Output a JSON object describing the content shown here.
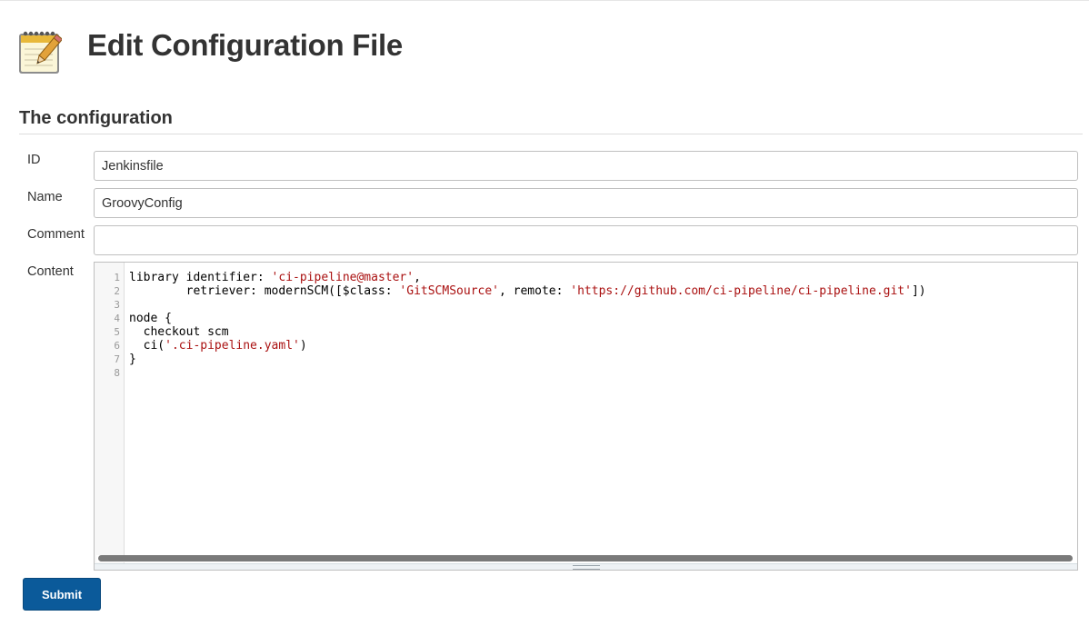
{
  "header": {
    "icon": "notepad-pencil-icon",
    "title": "Edit Configuration File"
  },
  "section": {
    "title": "The configuration"
  },
  "fields": {
    "id": {
      "label": "ID",
      "value": "Jenkinsfile"
    },
    "name": {
      "label": "Name",
      "value": "GroovyConfig"
    },
    "comment": {
      "label": "Comment",
      "value": ""
    },
    "content": {
      "label": "Content"
    }
  },
  "editor": {
    "line_numbers": [
      "1",
      "2",
      "3",
      "4",
      "5",
      "6",
      "7",
      "8"
    ],
    "lines": [
      {
        "plain1": "library identifier: ",
        "str1": "'ci-pipeline@master'",
        "plain2": ",",
        "str2": "",
        "plain3": "",
        "str3": "",
        "plain4": ""
      },
      {
        "plain1": "        retriever: modernSCM([$class: ",
        "str1": "'GitSCMSource'",
        "plain2": ", remote: ",
        "str2": "'https://github.com/ci-pipeline/ci-pipeline.git'",
        "plain3": "])",
        "str3": "",
        "plain4": ""
      },
      {
        "plain1": "",
        "str1": "",
        "plain2": "",
        "str2": "",
        "plain3": "",
        "str3": "",
        "plain4": ""
      },
      {
        "plain1": "node {",
        "str1": "",
        "plain2": "",
        "str2": "",
        "plain3": "",
        "str3": "",
        "plain4": ""
      },
      {
        "plain1": "  checkout scm",
        "str1": "",
        "plain2": "",
        "str2": "",
        "plain3": "",
        "str3": "",
        "plain4": ""
      },
      {
        "plain1": "  ci(",
        "str1": "'.ci-pipeline.yaml'",
        "plain2": ")",
        "str2": "",
        "plain3": "",
        "str3": "",
        "plain4": ""
      },
      {
        "plain1": "}",
        "str1": "",
        "plain2": "",
        "str2": "",
        "plain3": "",
        "str3": "",
        "plain4": ""
      },
      {
        "plain1": "",
        "str1": "",
        "plain2": "",
        "str2": "",
        "plain3": "",
        "str3": "",
        "plain4": ""
      }
    ]
  },
  "actions": {
    "submit_label": "Submit"
  },
  "colors": {
    "submit_button": "#0b5a9a",
    "code_string": "#aa1111"
  }
}
